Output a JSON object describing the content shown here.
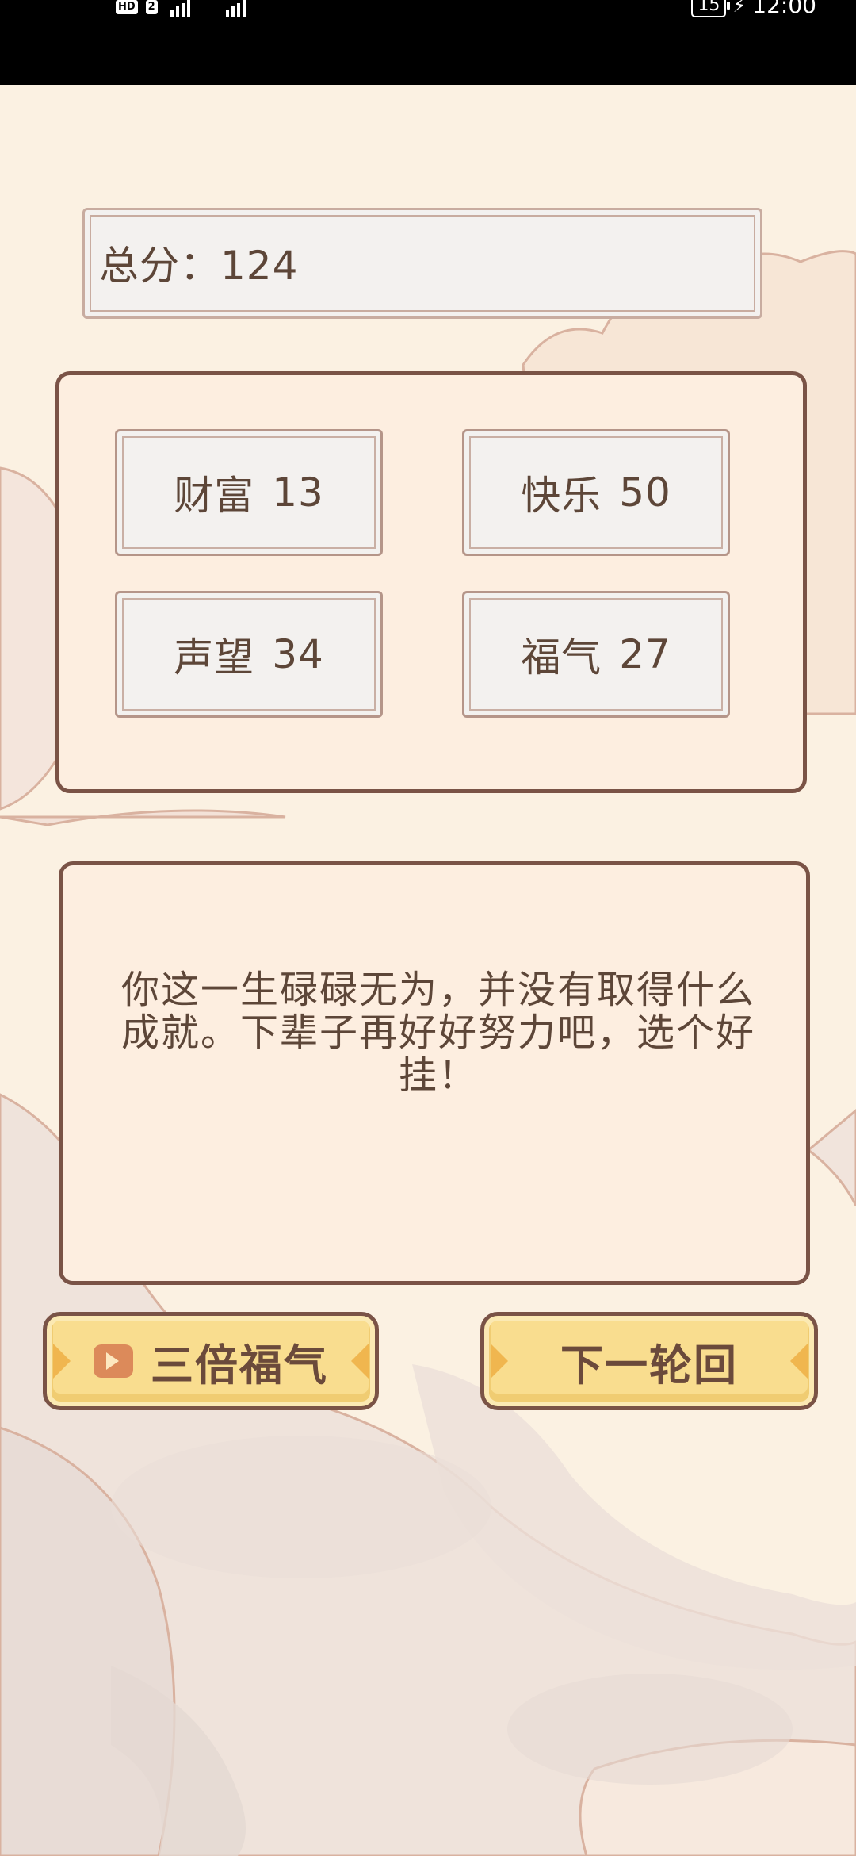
{
  "status_bar": {
    "hd_badge": "HD",
    "sim_badge": "2",
    "battery": "15",
    "time": "12:00"
  },
  "score": {
    "label": "总分：",
    "value": "124"
  },
  "stats": [
    {
      "label": "财富",
      "value": "13"
    },
    {
      "label": "快乐",
      "value": "50"
    },
    {
      "label": "声望",
      "value": "34"
    },
    {
      "label": "福气",
      "value": "27"
    }
  ],
  "message": "你这一生碌碌无为，并没有取得什么成就。下辈子再好好努力吧，选个好挂！",
  "buttons": {
    "triple_luck": "三倍福气",
    "next_round": "下一轮回"
  },
  "colors": {
    "panel_border": "#7a5346",
    "panel_fill": "#fdeee0",
    "button_fill": "#f9dd8f",
    "text": "#5d4638"
  }
}
